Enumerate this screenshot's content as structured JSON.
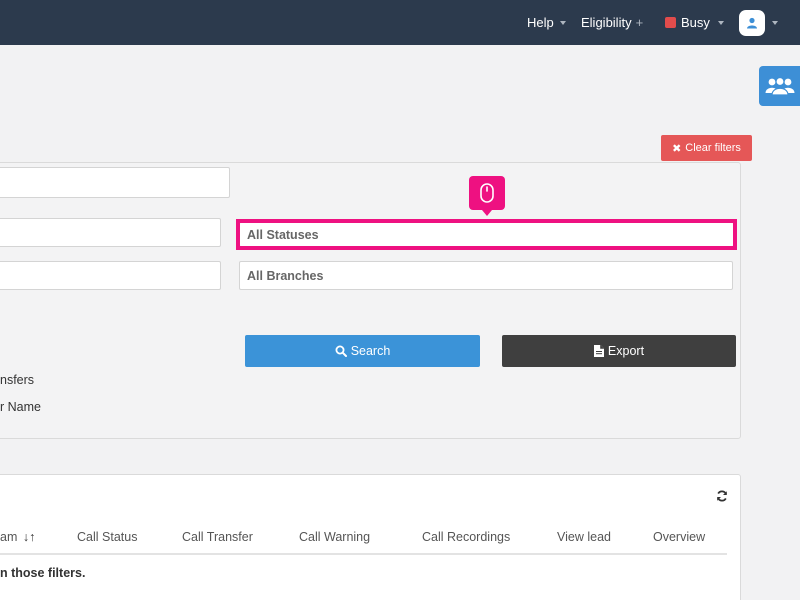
{
  "navbar": {
    "help": "Help",
    "eligibility": "Eligibility",
    "status": "Busy"
  },
  "filters": {
    "clear_label": "Clear filters",
    "status_select": "All Statuses",
    "branch_select": "All Branches",
    "search_label": "Search",
    "export_label": "Export",
    "option_transfers": "nsfers",
    "option_name": "r Name"
  },
  "table": {
    "columns": [
      "am",
      "Call Status",
      "Call Transfer",
      "Call Warning",
      "Call Recordings",
      "View lead",
      "Overview"
    ],
    "empty_message": "n those filters."
  },
  "colors": {
    "navbar": "#2c3a4d",
    "primary": "#3b93d8",
    "danger": "#e55757",
    "dark": "#3f3f3f",
    "highlight": "#ee1181",
    "busy": "#e24c4c"
  }
}
